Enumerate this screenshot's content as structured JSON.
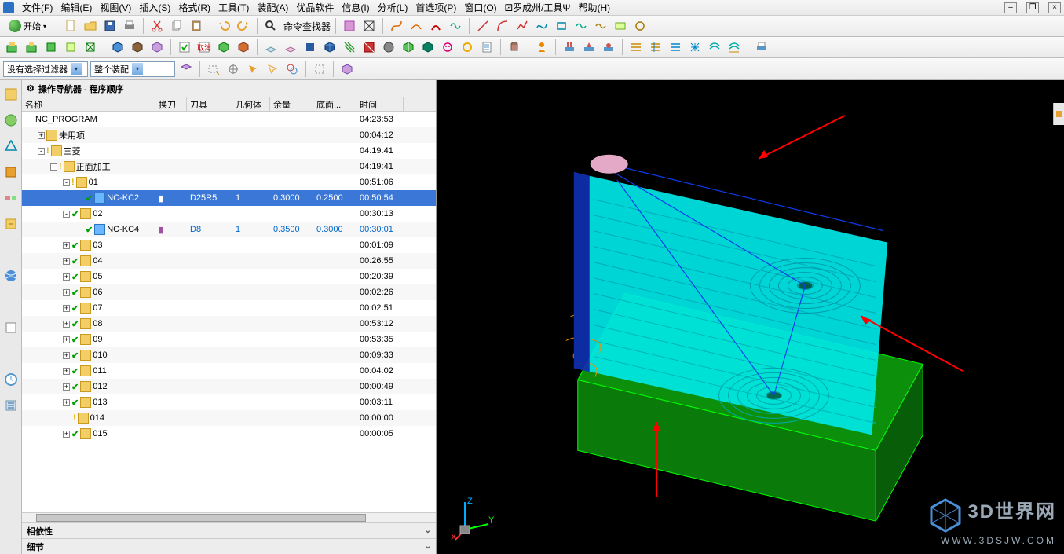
{
  "menus": [
    "文件(F)",
    "编辑(E)",
    "视图(V)",
    "插入(S)",
    "格式(R)",
    "工具(T)",
    "装配(A)",
    "优品软件",
    "信息(I)",
    "分析(L)",
    "首选项(P)",
    "窗口(O)",
    "⚂罗成州/工具Ψ",
    "帮助(H)"
  ],
  "start_label": "开始",
  "finder_label": "命令查找器",
  "filter1": "没有选择过滤器",
  "filter2": "整个装配",
  "nav_title": "操作导航器 - 程序顺序",
  "columns": {
    "name": "名称",
    "change": "换刀",
    "tool": "刀具",
    "geom": "几何体",
    "rem": "余量",
    "bot": "底面...",
    "time": "时间"
  },
  "rows": [
    {
      "indent": 0,
      "exp": "",
      "status": "",
      "icon": "",
      "name": "NC_PROGRAM",
      "time": "04:23:53"
    },
    {
      "indent": 1,
      "exp": "+",
      "status": "",
      "icon": "folder",
      "name": "未用项",
      "time": "00:04:12"
    },
    {
      "indent": 1,
      "exp": "-",
      "status": "warn",
      "icon": "folder",
      "name": "三菱",
      "time": "04:19:41"
    },
    {
      "indent": 2,
      "exp": "-",
      "status": "warn",
      "icon": "folder",
      "name": "正面加工",
      "time": "04:19:41"
    },
    {
      "indent": 3,
      "exp": "-",
      "status": "warn",
      "icon": "folder",
      "name": "01",
      "time": "00:51:06"
    },
    {
      "indent": 4,
      "exp": "",
      "status": "check",
      "icon": "program",
      "name": "NC-KC2",
      "change": "▮",
      "tool": "D25R5",
      "geom": "1",
      "rem": "0.3000",
      "bot": "0.2500",
      "time": "00:50:54",
      "selected": true
    },
    {
      "indent": 3,
      "exp": "-",
      "status": "check",
      "icon": "folder",
      "name": "02",
      "time": "00:30:13"
    },
    {
      "indent": 4,
      "exp": "",
      "status": "check",
      "icon": "program",
      "name": "NC-KC4",
      "change": "▮",
      "tool": "D8",
      "geom": "1",
      "rem": "0.3500",
      "bot": "0.3000",
      "time": "00:30:01"
    },
    {
      "indent": 3,
      "exp": "+",
      "status": "check",
      "icon": "folder",
      "name": "03",
      "time": "00:01:09"
    },
    {
      "indent": 3,
      "exp": "+",
      "status": "check",
      "icon": "folder",
      "name": "04",
      "time": "00:26:55"
    },
    {
      "indent": 3,
      "exp": "+",
      "status": "check",
      "icon": "folder",
      "name": "05",
      "time": "00:20:39"
    },
    {
      "indent": 3,
      "exp": "+",
      "status": "check",
      "icon": "folder",
      "name": "06",
      "time": "00:02:26"
    },
    {
      "indent": 3,
      "exp": "+",
      "status": "check",
      "icon": "folder",
      "name": "07",
      "time": "00:02:51"
    },
    {
      "indent": 3,
      "exp": "+",
      "status": "check",
      "icon": "folder",
      "name": "08",
      "time": "00:53:12"
    },
    {
      "indent": 3,
      "exp": "+",
      "status": "check",
      "icon": "folder",
      "name": "09",
      "time": "00:53:35"
    },
    {
      "indent": 3,
      "exp": "+",
      "status": "check",
      "icon": "folder",
      "name": "010",
      "time": "00:09:33"
    },
    {
      "indent": 3,
      "exp": "+",
      "status": "check",
      "icon": "folder",
      "name": "011",
      "time": "00:04:02"
    },
    {
      "indent": 3,
      "exp": "+",
      "status": "check",
      "icon": "folder",
      "name": "012",
      "time": "00:00:49"
    },
    {
      "indent": 3,
      "exp": "+",
      "status": "check",
      "icon": "folder",
      "name": "013",
      "time": "00:03:11"
    },
    {
      "indent": 3,
      "exp": "",
      "status": "warn",
      "icon": "folder",
      "name": "014",
      "time": "00:00:00"
    },
    {
      "indent": 3,
      "exp": "+",
      "status": "check",
      "icon": "folder",
      "name": "015",
      "time": "00:00:05"
    }
  ],
  "footer": {
    "depend": "相依性",
    "detail": "细节"
  },
  "watermark": {
    "big": "3D世界网",
    "small": "WWW.3DSJW.COM"
  }
}
